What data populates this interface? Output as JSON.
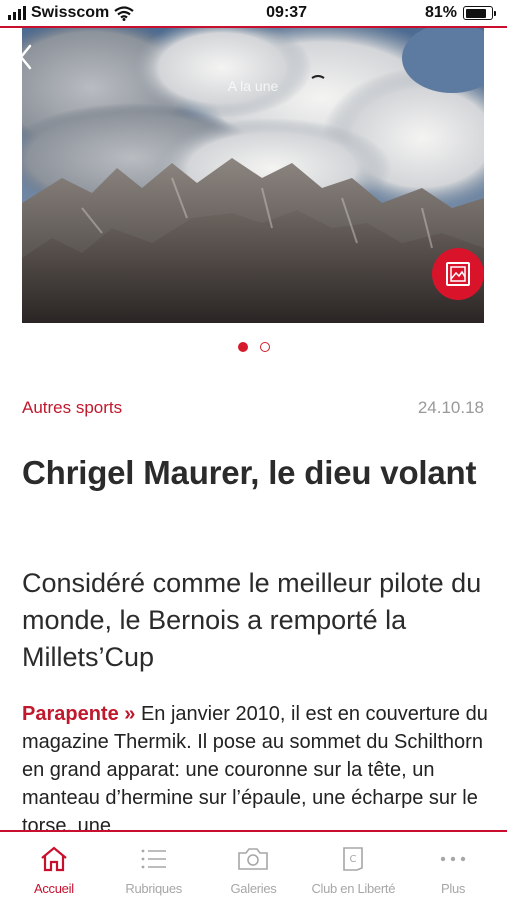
{
  "status_bar": {
    "carrier": "Swisscom",
    "time": "09:37",
    "battery_percent": "81%",
    "battery_level": 0.81,
    "icons": [
      "signal-icon",
      "wifi-icon",
      "battery-icon"
    ]
  },
  "hero": {
    "caption": "A la une",
    "slide_count": 2,
    "active_slide": 1,
    "icons": [
      "chevron-left-icon",
      "image-gallery-icon"
    ]
  },
  "article": {
    "category": "Autres sports",
    "date": "24.10.18",
    "title": "Chrigel Maurer, le dieu volant",
    "lead": "Considéré comme le meilleur pilote du monde, le Bernois a remporté la Millets’Cup",
    "kicker": "Parapente »",
    "body": " En janvier 2010, il est en couverture du magazine Thermik. Il pose au sommet du Schilthorn en grand apparat: une couronne sur la tête, un manteau d’hermine sur l’épaule, une écharpe sur le torse, une"
  },
  "tabbar": {
    "tabs": [
      {
        "label": "Accueil",
        "icon": "home-icon",
        "active": true
      },
      {
        "label": "Rubriques",
        "icon": "list-icon",
        "active": false
      },
      {
        "label": "Galeries",
        "icon": "camera-icon",
        "active": false
      },
      {
        "label": "Club en Liberté",
        "icon": "club-card-icon",
        "active": false
      },
      {
        "label": "Plus",
        "icon": "more-icon",
        "active": false
      }
    ]
  },
  "colors": {
    "accent": "#c8102e",
    "inactive_tab": "#a7a7a7",
    "date": "#999999"
  }
}
